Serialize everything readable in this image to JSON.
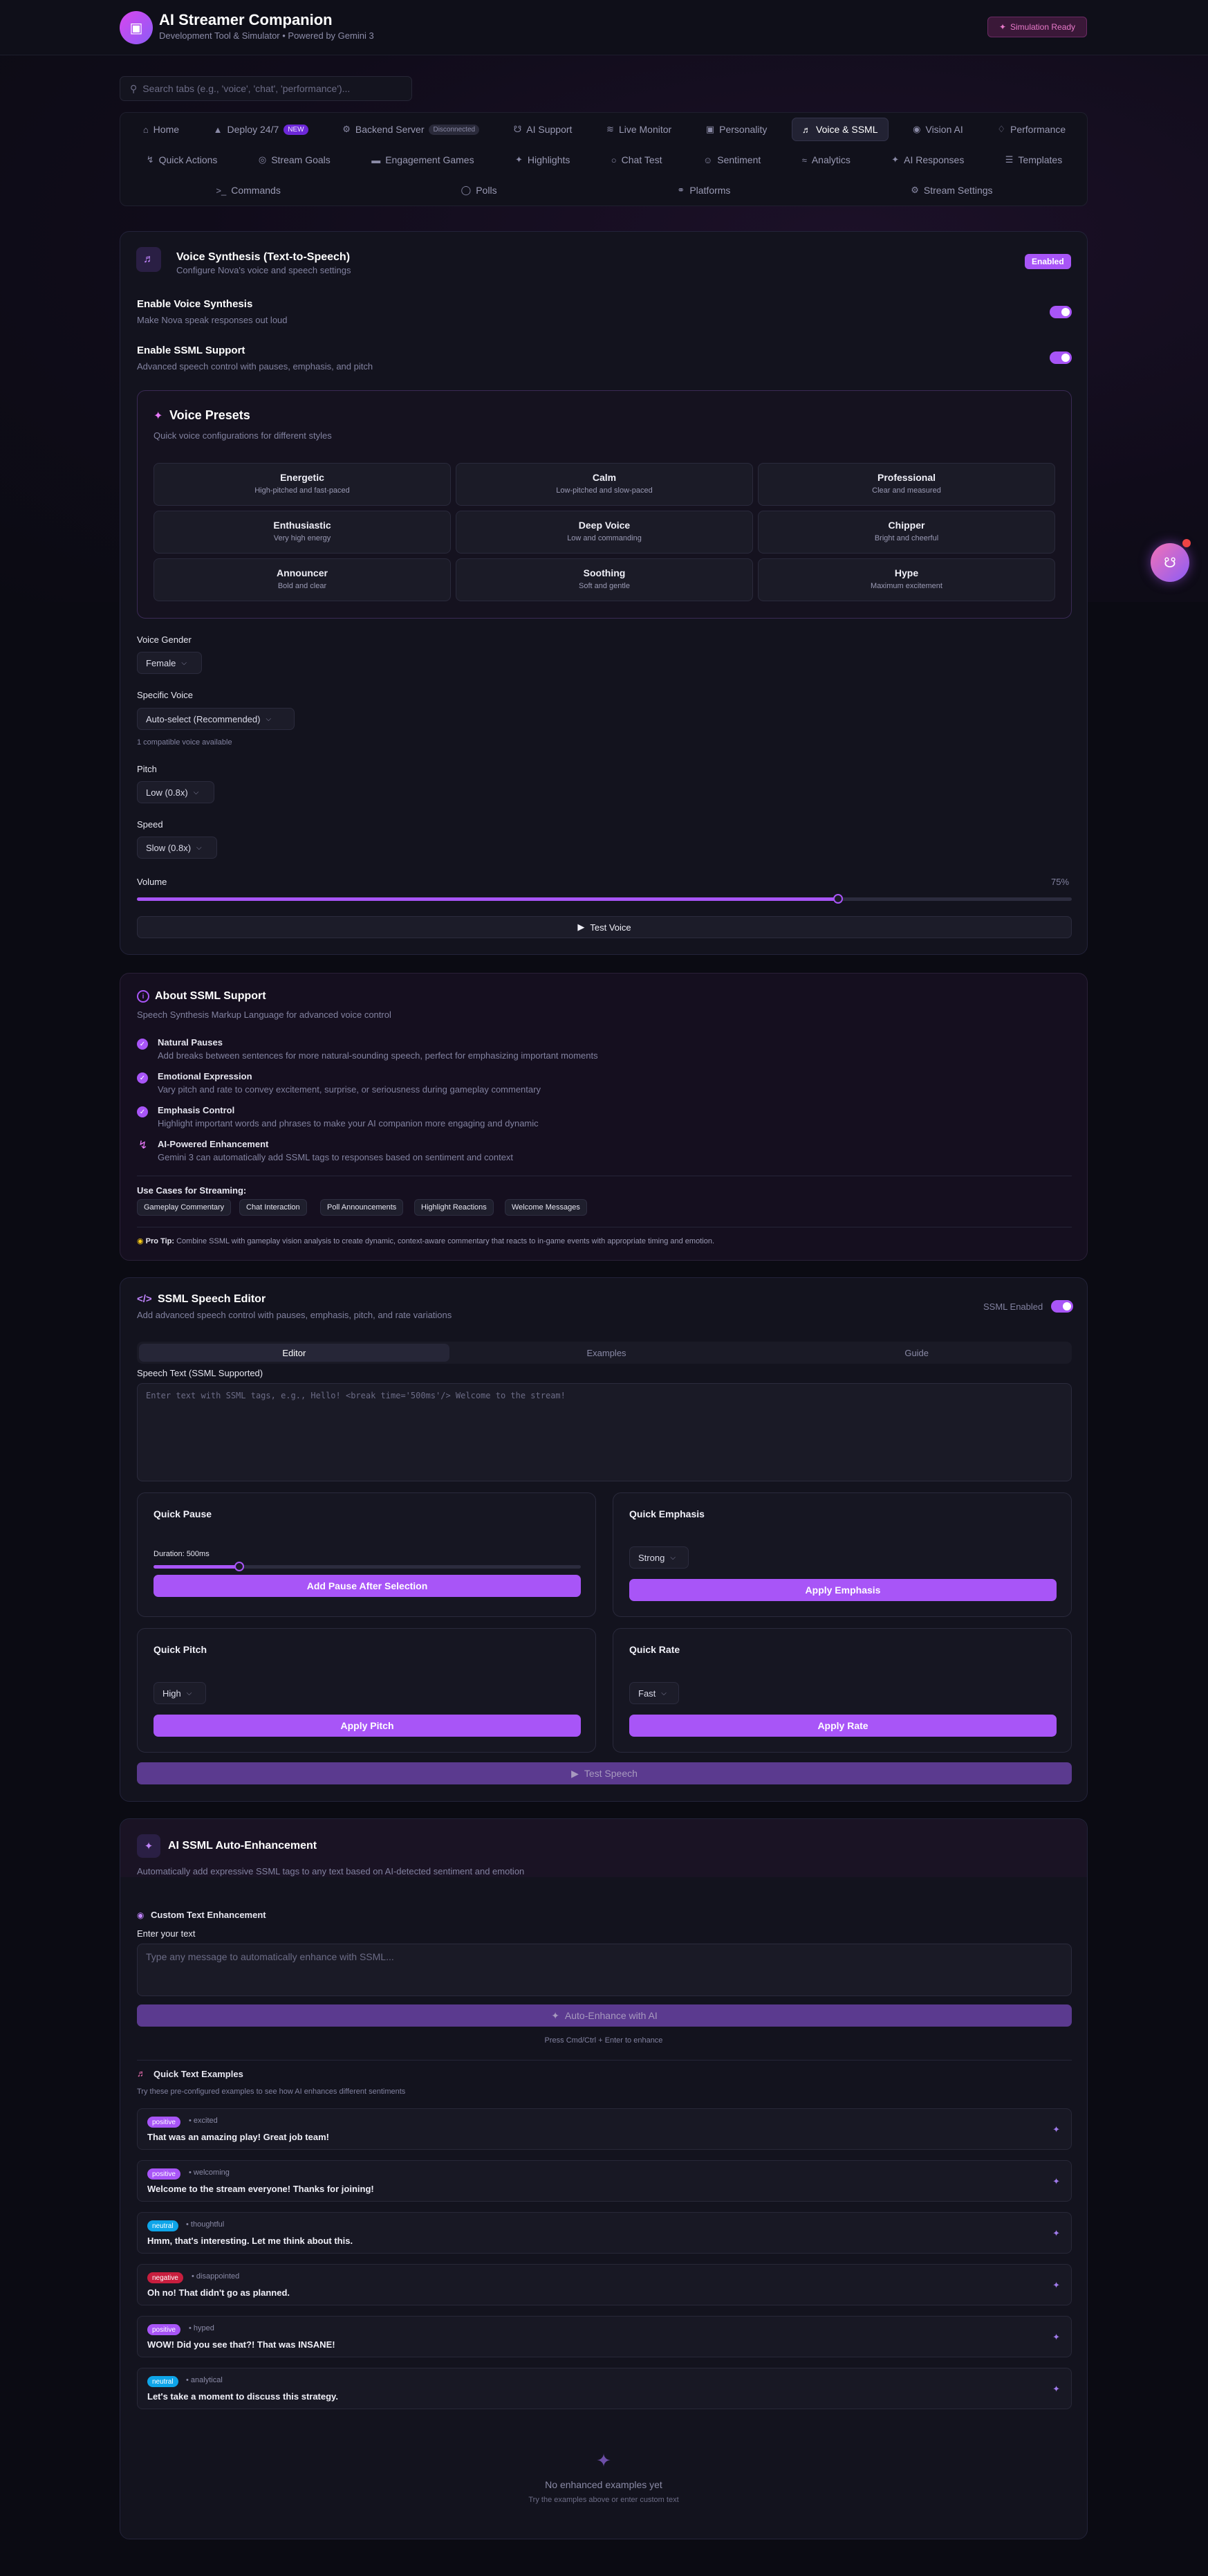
{
  "header": {
    "title": "AI Streamer Companion",
    "subtitle": "Development Tool & Simulator • Powered by Gemini 3",
    "status_badge": "Simulation Ready",
    "logo_icon": "robot-icon"
  },
  "search": {
    "placeholder": "Search tabs (e.g., 'voice', 'chat', 'performance')..."
  },
  "tabs": {
    "row1": [
      {
        "label": "Home",
        "icon": "home-icon"
      },
      {
        "label": "Deploy 24/7",
        "icon": "rocket-icon",
        "badge": "NEW"
      },
      {
        "label": "Backend Server",
        "icon": "server-icon",
        "badge": "Disconnected"
      },
      {
        "label": "AI Support",
        "icon": "headset-icon"
      },
      {
        "label": "Live Monitor",
        "icon": "activity-icon"
      },
      {
        "label": "Personality",
        "icon": "robot-icon"
      },
      {
        "label": "Voice & SSML",
        "icon": "speaker-icon",
        "active": true
      },
      {
        "label": "Vision AI",
        "icon": "eye-icon"
      },
      {
        "label": "Performance",
        "icon": "gauge-icon"
      }
    ],
    "row2": [
      {
        "label": "Quick Actions",
        "icon": "bolt-icon"
      },
      {
        "label": "Stream Goals",
        "icon": "target-icon"
      },
      {
        "label": "Engagement Games",
        "icon": "gamepad-icon"
      },
      {
        "label": "Highlights",
        "icon": "tag-icon"
      },
      {
        "label": "Chat Test",
        "icon": "chat-icon"
      },
      {
        "label": "Sentiment",
        "icon": "smile-icon"
      },
      {
        "label": "Analytics",
        "icon": "chart-icon"
      },
      {
        "label": "AI Responses",
        "icon": "sparkle-icon"
      },
      {
        "label": "Templates",
        "icon": "list-icon"
      }
    ],
    "row3": [
      {
        "label": "Commands",
        "icon": "terminal-icon"
      },
      {
        "label": "Polls",
        "icon": "poll-icon"
      },
      {
        "label": "Platforms",
        "icon": "link-icon"
      },
      {
        "label": "Stream Settings",
        "icon": "gear-icon"
      }
    ]
  },
  "voice": {
    "title": "Voice Synthesis (Text-to-Speech)",
    "subtitle": "Configure Nova's voice and speech settings",
    "badge": "Enabled",
    "enable_voice_label": "Enable Voice Synthesis",
    "enable_voice_desc": "Make Nova speak responses out loud",
    "enable_ssml_label": "Enable SSML Support",
    "enable_ssml_desc": "Advanced speech control with pauses, emphasis, and pitch",
    "presets_title": "Voice Presets",
    "presets_desc": "Quick voice configurations for different styles",
    "presets": [
      {
        "name": "Energetic",
        "desc": "High-pitched and fast-paced"
      },
      {
        "name": "Calm",
        "desc": "Low-pitched and slow-paced"
      },
      {
        "name": "Professional",
        "desc": "Clear and measured"
      },
      {
        "name": "Enthusiastic",
        "desc": "Very high energy"
      },
      {
        "name": "Deep Voice",
        "desc": "Low and commanding"
      },
      {
        "name": "Chipper",
        "desc": "Bright and cheerful"
      },
      {
        "name": "Announcer",
        "desc": "Bold and clear"
      },
      {
        "name": "Soothing",
        "desc": "Soft and gentle"
      },
      {
        "name": "Hype",
        "desc": "Maximum excitement"
      }
    ],
    "gender_label": "Voice Gender",
    "gender_value": "Female",
    "specific_label": "Specific Voice",
    "specific_value": "Auto-select (Recommended)",
    "compat_note": "1 compatible voice available",
    "pitch_label": "Pitch",
    "pitch_value": "Low (0.8x)",
    "speed_label": "Speed",
    "speed_value": "Slow (0.8x)",
    "volume_label": "Volume",
    "volume_text": "75%",
    "volume_fraction": 0.75,
    "test_button": "Test Voice"
  },
  "about": {
    "title": "About SSML Support",
    "subtitle": "Speech Synthesis Markup Language for advanced voice control",
    "items": [
      {
        "title": "Natural Pauses",
        "desc": "Add breaks between sentences for more natural-sounding speech, perfect for emphasizing important moments"
      },
      {
        "title": "Emotional Expression",
        "desc": "Vary pitch and rate to convey excitement, surprise, or seriousness during gameplay commentary"
      },
      {
        "title": "Emphasis Control",
        "desc": "Highlight important words and phrases to make your AI companion more engaging and dynamic"
      },
      {
        "title": "AI-Powered Enhancement",
        "desc": "Gemini 3 can automatically add SSML tags to responses based on sentiment and context"
      }
    ],
    "use_cases_title": "Use Cases for Streaming:",
    "use_cases": [
      "Gameplay Commentary",
      "Chat Interaction",
      "Poll Announcements",
      "Highlight Reactions",
      "Welcome Messages"
    ],
    "pro_tip_label": "Pro Tip:",
    "pro_tip": "Combine SSML with gameplay vision analysis to create dynamic, context-aware commentary that reacts to in-game events with appropriate timing and emotion."
  },
  "editor": {
    "title": "SSML Speech Editor",
    "subtitle": "Add advanced speech control with pauses, emphasis, pitch, and rate variations",
    "toggle_label": "SSML Enabled",
    "tabs": [
      "Editor",
      "Examples",
      "Guide"
    ],
    "text_label": "Speech Text (SSML Supported)",
    "text_placeholder": "Enter text with SSML tags, e.g., Hello! <break time='500ms'/> Welcome to the stream!",
    "pause_title": "Quick Pause",
    "pause_duration": "Duration: 500ms",
    "pause_fraction": 0.2,
    "pause_button": "Add Pause After Selection",
    "emphasis_title": "Quick Emphasis",
    "emphasis_value": "Strong",
    "emphasis_button": "Apply Emphasis",
    "pitch_title": "Quick Pitch",
    "pitch_value": "High",
    "pitch_button": "Apply Pitch",
    "rate_title": "Quick Rate",
    "rate_value": "Fast",
    "rate_button": "Apply Rate",
    "test_button": "Test Speech"
  },
  "auto": {
    "title": "AI SSML Auto-Enhancement",
    "subtitle": "Automatically add expressive SSML tags to any text based on AI-detected sentiment and emotion",
    "custom_title": "Custom Text Enhancement",
    "input_label": "Enter your text",
    "input_placeholder": "Type any message to automatically enhance with SSML...",
    "enhance_button": "Auto-Enhance with AI",
    "hint": "Press Cmd/Ctrl + Enter to enhance",
    "examples_title": "Quick Text Examples",
    "examples_desc": "Try these pre-configured examples to see how AI enhances different sentiments",
    "examples": [
      {
        "tag": "positive",
        "emotion": "• excited",
        "text": "That was an amazing play! Great job team!"
      },
      {
        "tag": "positive",
        "emotion": "• welcoming",
        "text": "Welcome to the stream everyone! Thanks for joining!"
      },
      {
        "tag": "neutral",
        "emotion": "• thoughtful",
        "text": "Hmm, that's interesting. Let me think about this."
      },
      {
        "tag": "negative",
        "emotion": "• disappointed",
        "text": "Oh no! That didn't go as planned."
      },
      {
        "tag": "positive",
        "emotion": "• hyped",
        "text": "WOW! Did you see that?! That was INSANE!"
      },
      {
        "tag": "neutral",
        "emotion": "• analytical",
        "text": "Let's take a moment to discuss this strategy."
      }
    ],
    "empty_title": "No enhanced examples yet",
    "empty_desc": "Try the examples above or enter custom text"
  },
  "colors": {
    "accent": "#a855f7",
    "background": "#0b0b13",
    "card": "#13131e"
  }
}
